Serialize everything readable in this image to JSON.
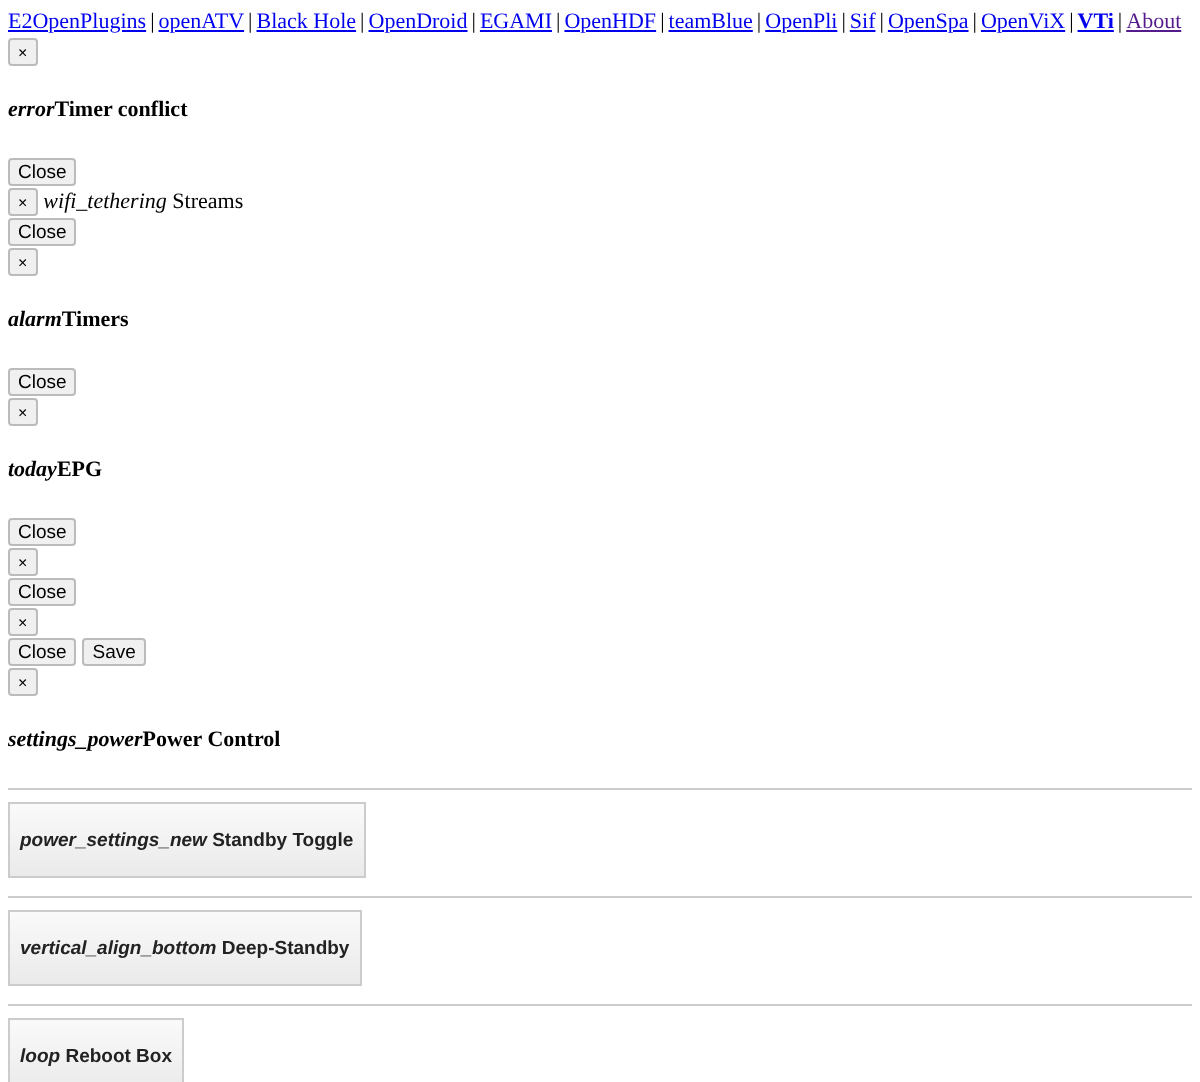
{
  "nav": [
    {
      "label": "E2OpenPlugins",
      "bold": false,
      "visited": false
    },
    {
      "label": "openATV",
      "bold": false,
      "visited": false
    },
    {
      "label": "Black Hole",
      "bold": false,
      "visited": false
    },
    {
      "label": "OpenDroid",
      "bold": false,
      "visited": false
    },
    {
      "label": "EGAMI",
      "bold": false,
      "visited": false
    },
    {
      "label": "OpenHDF",
      "bold": false,
      "visited": false
    },
    {
      "label": "teamBlue",
      "bold": false,
      "visited": false
    },
    {
      "label": "OpenPli",
      "bold": false,
      "visited": false
    },
    {
      "label": "Sif",
      "bold": false,
      "visited": false
    },
    {
      "label": "OpenSpa",
      "bold": false,
      "visited": false
    },
    {
      "label": "OpenViX",
      "bold": false,
      "visited": false
    },
    {
      "label": "VTi",
      "bold": true,
      "visited": false
    },
    {
      "label": "About",
      "bold": false,
      "visited": true
    }
  ],
  "separator": "|",
  "blocks": [
    {
      "kind": "buttons",
      "buttons": [
        {
          "kind": "dismiss",
          "label": "×"
        }
      ]
    },
    {
      "kind": "heading",
      "icon": "error",
      "title": "Timer conflict"
    },
    {
      "kind": "buttons",
      "buttons": [
        {
          "kind": "close",
          "label": "Close"
        }
      ]
    },
    {
      "kind": "x_row",
      "button": "×",
      "text": "*wifi_tethering* Streams"
    },
    {
      "kind": "buttons",
      "buttons": [
        {
          "kind": "close",
          "label": "Close"
        }
      ]
    },
    {
      "kind": "buttons",
      "buttons": [
        {
          "kind": "dismiss",
          "label": "×"
        }
      ]
    },
    {
      "kind": "heading",
      "icon": "alarm",
      "title": "Timers"
    },
    {
      "kind": "buttons",
      "buttons": [
        {
          "kind": "close",
          "label": "Close"
        }
      ]
    },
    {
      "kind": "buttons",
      "buttons": [
        {
          "kind": "dismiss",
          "label": "×"
        }
      ]
    },
    {
      "kind": "heading",
      "icon": "today",
      "title": "EPG"
    },
    {
      "kind": "buttons",
      "buttons": [
        {
          "kind": "close",
          "label": "Close"
        }
      ]
    },
    {
      "kind": "buttons",
      "buttons": [
        {
          "kind": "dismiss",
          "label": "×"
        }
      ]
    },
    {
      "kind": "buttons",
      "buttons": [
        {
          "kind": "close",
          "label": "Close"
        }
      ]
    },
    {
      "kind": "buttons",
      "buttons": [
        {
          "kind": "dismiss",
          "label": "×"
        }
      ]
    },
    {
      "kind": "buttons",
      "buttons": [
        {
          "kind": "close",
          "label": "Close"
        },
        {
          "kind": "save",
          "label": "Save"
        }
      ]
    },
    {
      "kind": "buttons",
      "buttons": [
        {
          "kind": "dismiss",
          "label": "×"
        }
      ]
    },
    {
      "kind": "heading",
      "icon": "settings_power",
      "title": "Power Control"
    },
    {
      "kind": "power",
      "text": "*power_settings_new* Standby Toggle"
    },
    {
      "kind": "power",
      "text": "*vertical_align_bottom* Deep-Standby"
    },
    {
      "kind": "power",
      "text": "*loop* Reboot Box"
    }
  ]
}
